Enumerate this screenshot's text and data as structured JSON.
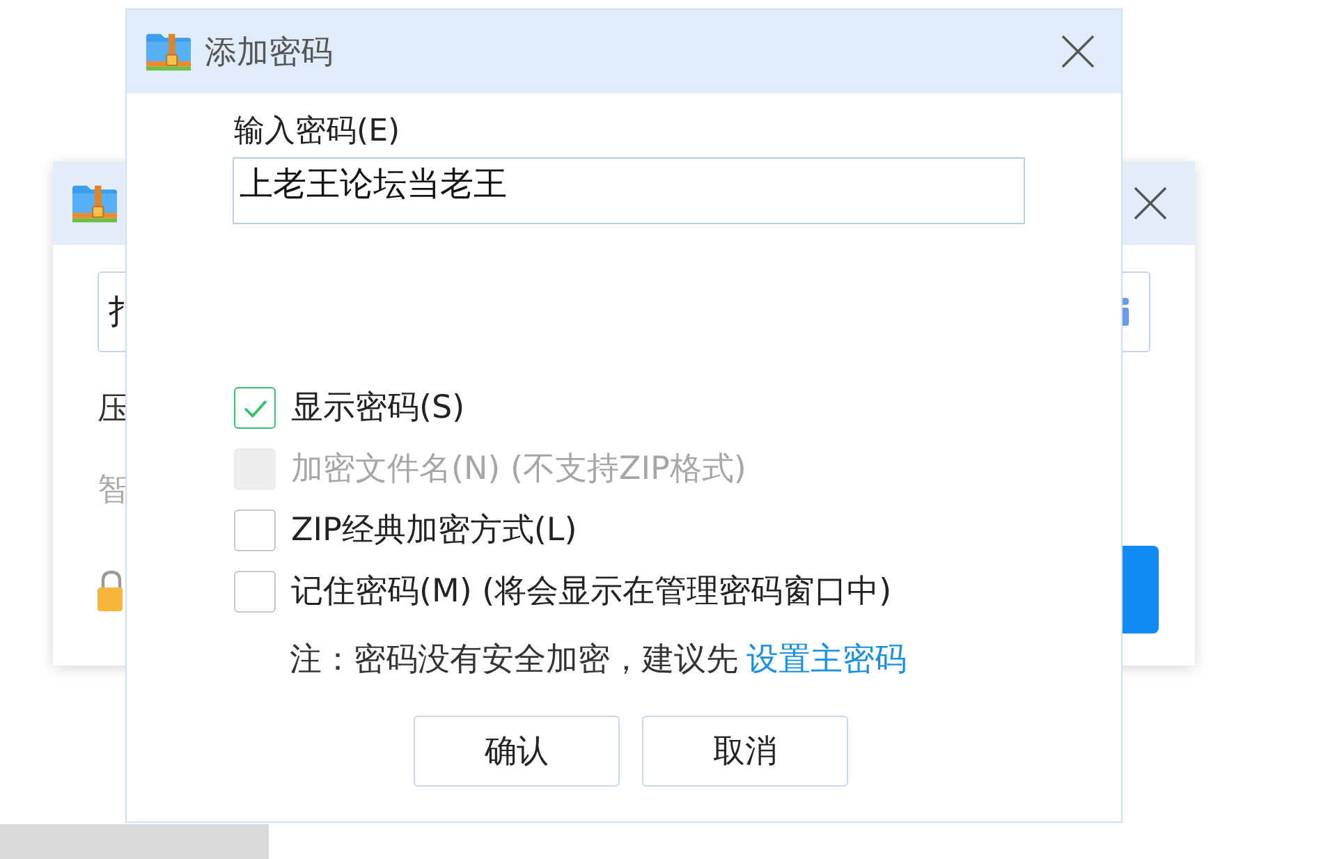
{
  "background_window": {
    "field": {
      "value": "扌"
    },
    "labels": [
      {
        "text": "压",
        "disabled": false
      },
      {
        "text": "智",
        "disabled": true
      }
    ]
  },
  "dialog": {
    "title": "添加密码"
  },
  "password": {
    "label": "输入密码(E)",
    "value": "上老王论坛当老王"
  },
  "options": [
    {
      "label": "显示密码(S)",
      "checked": true,
      "disabled": false
    },
    {
      "label": "加密文件名(N) (不支持ZIP格式)",
      "checked": false,
      "disabled": true
    },
    {
      "label": "ZIP经典加密方式(L)",
      "checked": false,
      "disabled": false
    },
    {
      "label": "记住密码(M) (将会显示在管理密码窗口中)",
      "checked": false,
      "disabled": false
    }
  ],
  "note": {
    "text": "注：密码没有安全加密，建议先",
    "link": "设置主密码"
  },
  "buttons": [
    {
      "label": "确认"
    },
    {
      "label": "取消"
    }
  ]
}
